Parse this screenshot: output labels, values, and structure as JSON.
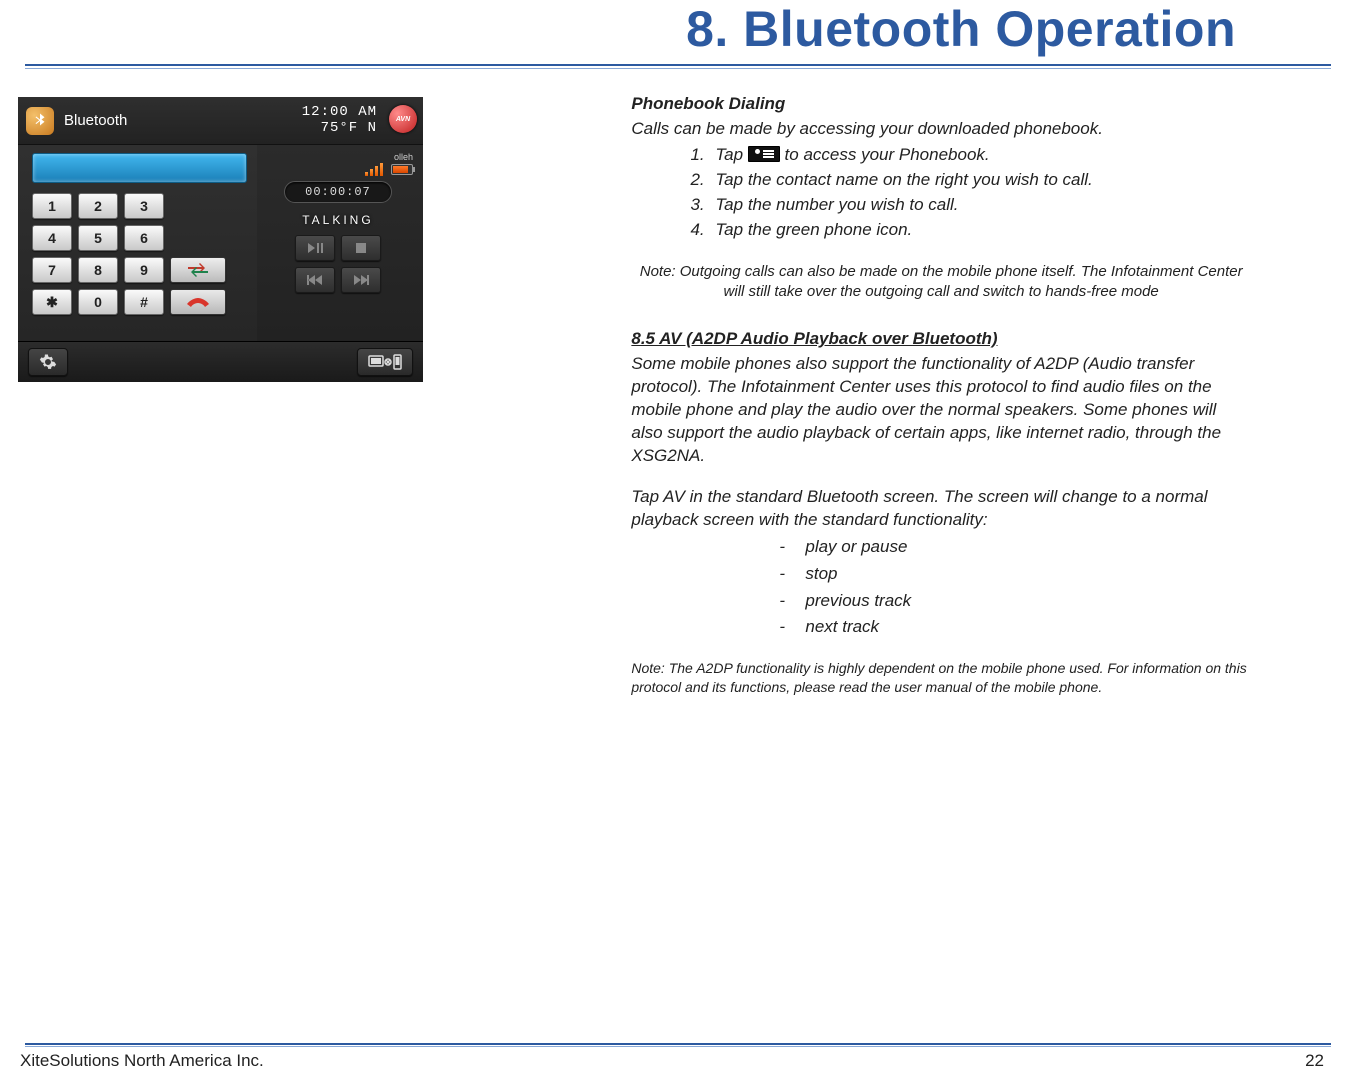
{
  "header": {
    "title": "8. Bluetooth Operation"
  },
  "phonebook": {
    "heading": "Phonebook Dialing",
    "intro": "Calls can be made by accessing your downloaded phonebook.",
    "step1_pre": "Tap ",
    "step1_post": " to access your Phonebook.",
    "step2": "Tap the contact name on the right you wish to call.",
    "step3": "Tap the number you wish to call.",
    "step4": "Tap the green phone icon.",
    "note": "Note: Outgoing calls can also be made on the mobile phone itself. The Infotainment Center will still take over the outgoing call and switch to hands-free mode"
  },
  "a2dp": {
    "heading": "8.5  AV (A2DP Audio Playback over Bluetooth)",
    "para1": "Some mobile phones also support the functionality of A2DP (Audio transfer protocol). The Infotainment Center uses this protocol to find audio files on the mobile phone and play the audio over the normal speakers. Some phones will also support the audio playback of certain apps, like internet radio, through the XSG2NA.",
    "para2": "Tap AV in the standard Bluetooth screen. The screen will change to a normal playback screen with the standard functionality:",
    "items": {
      "i1": "play or pause",
      "i2": "stop",
      "i3": "previous track",
      "i4": "next track"
    },
    "note": "Note: The A2DP functionality is highly dependent on the mobile phone used. For information on this protocol and its functions, please read the user manual of the mobile phone."
  },
  "device": {
    "title": "Bluetooth",
    "clock": "12:00 AM",
    "temp": "75°F  N",
    "carrier": "olleh",
    "timer": "00:00:07",
    "status": "TALKING",
    "keys": {
      "k1": "1",
      "k2": "2",
      "k3": "3",
      "k4": "4",
      "k5": "5",
      "k6": "6",
      "k7": "7",
      "k8": "8",
      "k9": "9",
      "ks": "✱",
      "k0": "0",
      "kh": "#"
    },
    "avn": "AVN"
  },
  "footer": {
    "company": "XiteSolutions North America Inc.",
    "page": "22"
  }
}
